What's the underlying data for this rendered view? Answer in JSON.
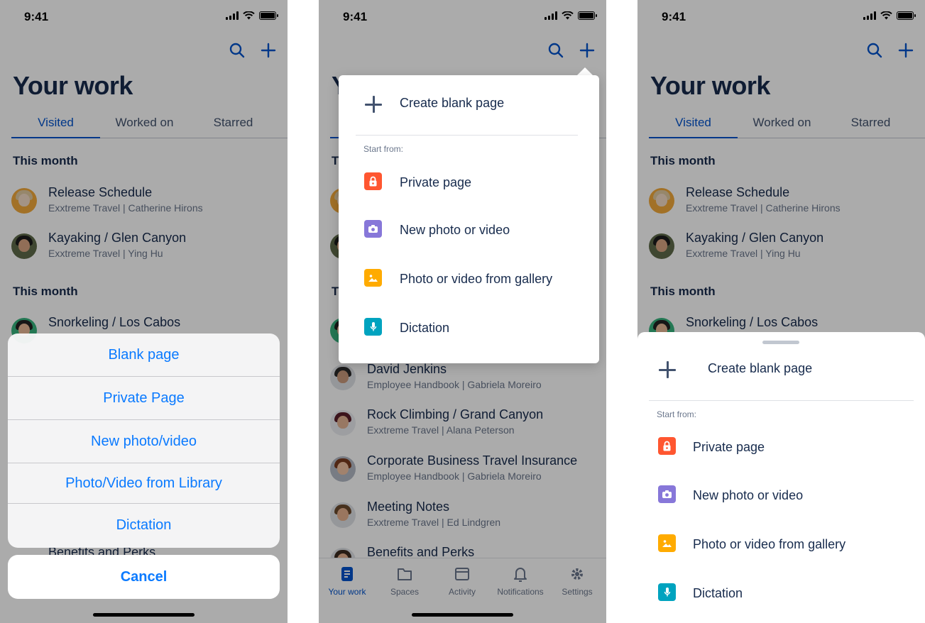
{
  "status": {
    "time": "9:41"
  },
  "screen": {
    "title": "Your work",
    "tabs": [
      "Visited",
      "Worked on",
      "Starred"
    ],
    "sections": [
      "This month",
      "This month"
    ],
    "items": [
      {
        "title": "Release Schedule",
        "subtitle": "Exxtreme Travel | Catherine Hirons"
      },
      {
        "title": "Kayaking / Glen Canyon",
        "subtitle": "Exxtreme Travel | Ying Hu"
      },
      {
        "title": "Snorkeling / Los Cabos",
        "subtitle": ""
      },
      {
        "title": "David Jenkins",
        "subtitle": "Employee Handbook | Gabriela Moreiro"
      },
      {
        "title": "Rock Climbing / Grand Canyon",
        "subtitle": "Exxtreme Travel | Alana Peterson"
      },
      {
        "title": "Corporate Business Travel Insurance",
        "subtitle": "Employee Handbook | Gabriela Moreiro"
      },
      {
        "title": "Meeting Notes",
        "subtitle": "Exxtreme Travel | Ed Lindgren"
      },
      {
        "title": "Benefits and Perks",
        "subtitle": ""
      }
    ]
  },
  "nav": [
    {
      "label": "Your work",
      "icon": "document-icon"
    },
    {
      "label": "Spaces",
      "icon": "folder-icon"
    },
    {
      "label": "Activity",
      "icon": "activity-icon"
    },
    {
      "label": "Notifications",
      "icon": "bell-icon"
    },
    {
      "label": "Settings",
      "icon": "gear-icon"
    }
  ],
  "action_sheet": {
    "options": [
      "Blank page",
      "Private Page",
      "New photo/video",
      "Photo/Video from Library",
      "Dictation"
    ],
    "cancel": "Cancel"
  },
  "create_menu": {
    "create_label": "Create blank page",
    "start_from": "Start from:",
    "options": [
      {
        "label": "Private page",
        "icon": "lock-icon",
        "color": "#ff5630"
      },
      {
        "label": "New photo or video",
        "icon": "camera-icon",
        "color": "#8777d9"
      },
      {
        "label": "Photo or video from gallery",
        "icon": "image-icon",
        "color": "#ffab00"
      },
      {
        "label": "Dictation",
        "icon": "microphone-icon",
        "color": "#00a3bf"
      }
    ]
  },
  "colors": {
    "primary": "#0052cc",
    "ios_blue": "#0a7aff",
    "text": "#172b4d",
    "subtext": "#6b778c"
  }
}
